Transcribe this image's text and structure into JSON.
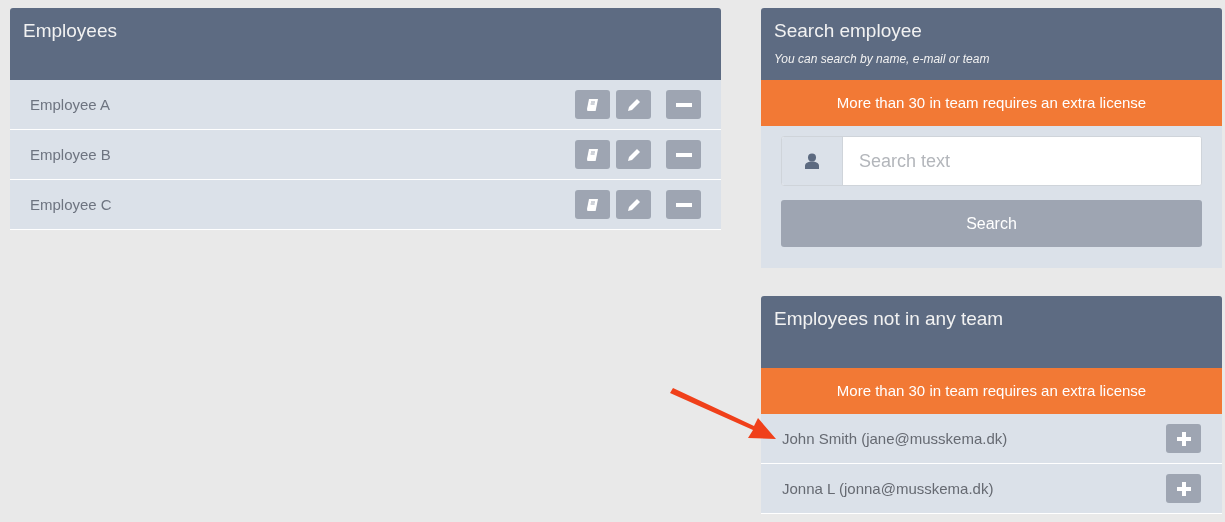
{
  "employees_panel": {
    "title": "Employees",
    "rows": [
      {
        "name": "Employee A"
      },
      {
        "name": "Employee B"
      },
      {
        "name": "Employee C"
      }
    ]
  },
  "search_panel": {
    "title": "Search employee",
    "subtitle": "You can search by name, e-mail or team",
    "notice": "More than 30 in team requires an extra license",
    "search_field": {
      "placeholder": "Search text"
    },
    "button": "Search"
  },
  "unassigned_panel": {
    "title": "Employees not in any team",
    "notice": "More than 30 in team requires an extra license",
    "rows": [
      {
        "name": "John Smith (jane@musskema.dk)"
      },
      {
        "name": "Jonna L (jonna@musskema.dk)"
      }
    ]
  }
}
